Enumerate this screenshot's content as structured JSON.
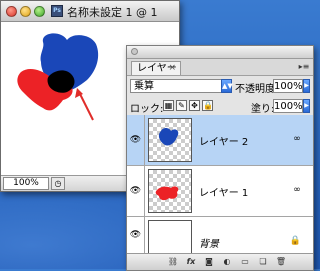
{
  "document": {
    "title": "名称未設定 1 @ 1",
    "zoom": "100%",
    "canvas_colors": {
      "blue": "#1a47b8",
      "red": "#ec2226",
      "black": "#000000",
      "arrow": "#e02d2a"
    }
  },
  "layers_panel": {
    "tab_label": "レイヤー",
    "tab_close": "×",
    "blend_mode": "乗算",
    "opacity_label": "不透明度:",
    "opacity_value": "100%",
    "lock_label": "ロック:",
    "fill_label": "塗り:",
    "fill_value": "100%",
    "layers": [
      {
        "name": "レイヤー 2",
        "selected": true,
        "shape_color": "#1a47b8"
      },
      {
        "name": "レイヤー 1",
        "selected": false,
        "shape_color": "#ec2226"
      },
      {
        "name": "背景",
        "selected": false
      }
    ],
    "bottom_buttons": [
      "link",
      "fx",
      "mask",
      "adjust",
      "folder",
      "new",
      "trash"
    ]
  }
}
